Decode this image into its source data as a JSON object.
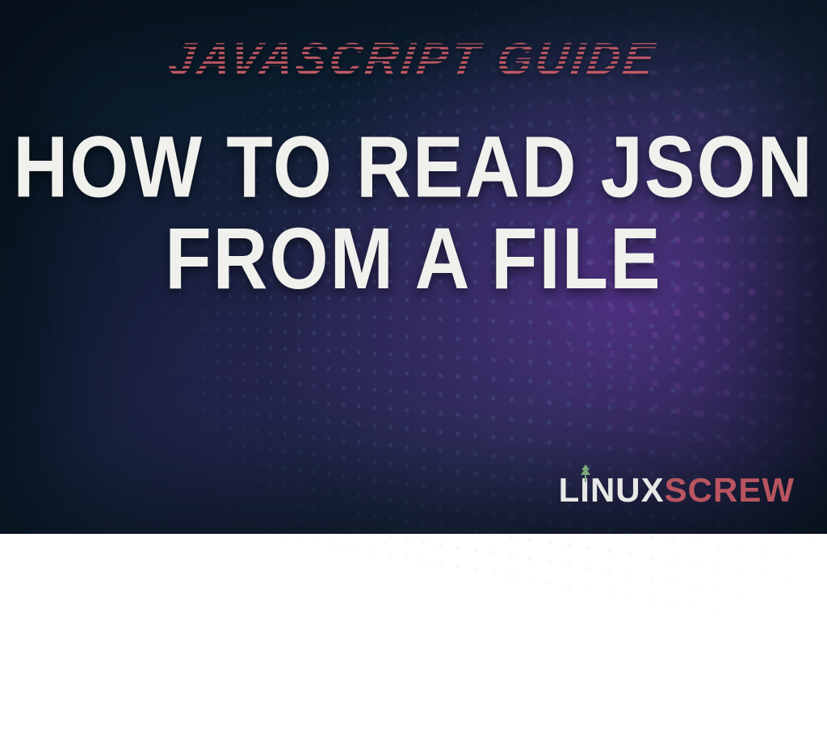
{
  "banner": {
    "subtitle": "JAVASCRIPT GUIDE",
    "title_line1": "HOW TO READ JSON",
    "title_line2": "FROM A FILE"
  },
  "logo": {
    "part1": "L",
    "part_i": "I",
    "part2": "NUX",
    "part3": "SCREW",
    "tree_icon": "🌲"
  },
  "colors": {
    "subtitle": "#b85560",
    "title": "#f0f0ed",
    "logo_primary": "#e8e8e6",
    "logo_accent": "#b85560",
    "tree": "#7aa87a"
  }
}
